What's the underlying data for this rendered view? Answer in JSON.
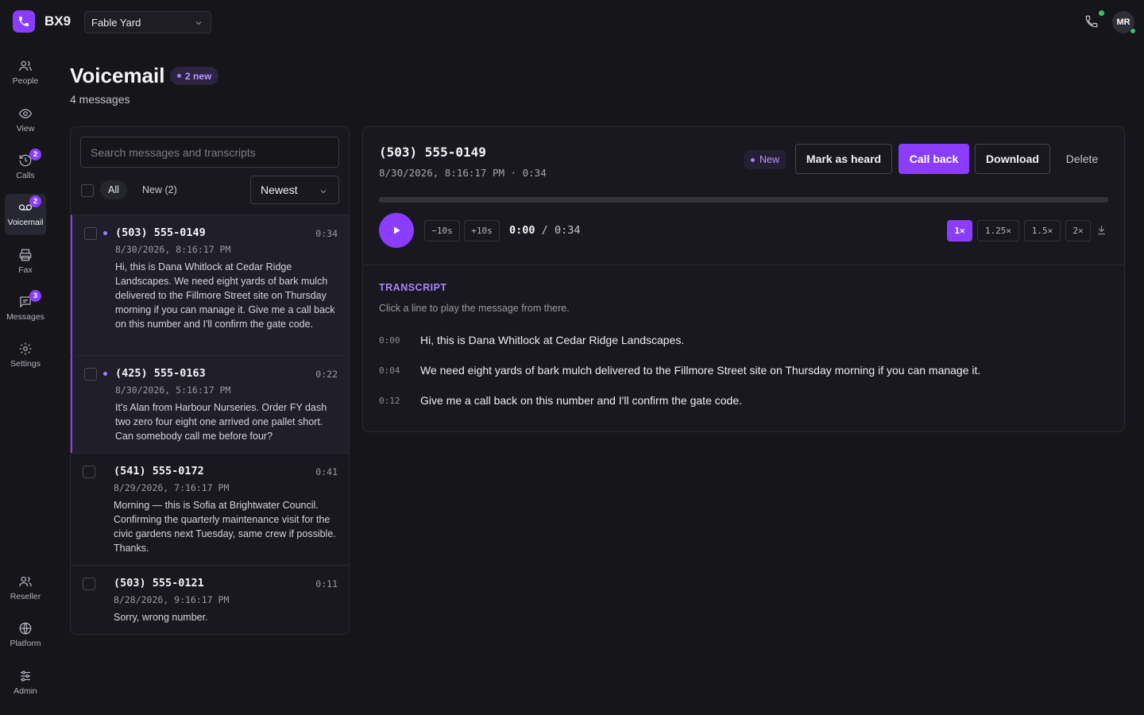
{
  "app": {
    "brand": "BX9",
    "workspace": "Fable Yard",
    "user_initials": "MR"
  },
  "nav": {
    "people": "People",
    "view": "View",
    "calls": "Calls",
    "calls_badge": "2",
    "voicemail": "Voicemail",
    "voicemail_badge": "2",
    "fax": "Fax",
    "messages": "Messages",
    "messages_badge": "3",
    "settings": "Settings",
    "reseller": "Reseller",
    "platform": "Platform",
    "admin": "Admin"
  },
  "header": {
    "title": "Voicemail",
    "new_badge": "2 new",
    "subtitle": "4 messages"
  },
  "list": {
    "search_placeholder": "Search messages and transcripts",
    "filter_all": "All",
    "filter_new": "New (2)",
    "sort_selected": "Newest",
    "messages": [
      {
        "phone": "(503) 555-0149",
        "duration": "0:34",
        "date": "8/30/2026, 8:16:17 PM",
        "text": "Hi, this is Dana Whitlock at Cedar Ridge Landscapes. We need eight yards of bark mulch delivered to the Fillmore Street site on Thursday morning if you can manage it. Give me a call back on this number and I'll confirm the gate code.",
        "unread": true,
        "selected": true
      },
      {
        "phone": "(425) 555-0163",
        "duration": "0:22",
        "date": "8/30/2026, 5:16:17 PM",
        "text": "It's Alan from Harbour Nurseries. Order FY dash two zero four eight one arrived one pallet short. Can somebody call me before four?",
        "unread": true,
        "selected": false
      },
      {
        "phone": "(541) 555-0172",
        "duration": "0:41",
        "date": "8/29/2026, 7:16:17 PM",
        "text": "Morning — this is Sofia at Brightwater Council. Confirming the quarterly maintenance visit for the civic gardens next Tuesday, same crew if possible. Thanks.",
        "unread": false,
        "selected": false
      },
      {
        "phone": "(503) 555-0121",
        "duration": "0:11",
        "date": "8/28/2026, 9:16:17 PM",
        "text": "Sorry, wrong number.",
        "unread": false,
        "selected": false
      }
    ]
  },
  "detail": {
    "phone": "(503) 555-0149",
    "meta": "8/30/2026, 8:16:17 PM · 0:34",
    "status": "New",
    "mark_heard": "Mark as heard",
    "call_back": "Call back",
    "download": "Download",
    "delete": "Delete",
    "progress_fraction": 0,
    "back10": "−10s",
    "fwd10": "+10s",
    "current_time": "0:00",
    "separator": "/",
    "total_time": "0:34",
    "speeds": [
      "1×",
      "1.25×",
      "1.5×",
      "2×"
    ],
    "active_speed": "1×",
    "transcript_heading": "TRANSCRIPT",
    "transcript_hint": "Click a line to play the message from there.",
    "transcript": [
      {
        "time": "0:00",
        "text": "Hi, this is Dana Whitlock at Cedar Ridge Landscapes."
      },
      {
        "time": "0:04",
        "text": "We need eight yards of bark mulch delivered to the Fillmore Street site on Thursday morning if you can manage it."
      },
      {
        "time": "0:12",
        "text": "Give me a call back on this number and I'll confirm the gate code."
      }
    ]
  },
  "colors": {
    "accent": "#8b3dff",
    "background": "#15151a",
    "panel": "#18181e",
    "online": "#2ec866"
  }
}
